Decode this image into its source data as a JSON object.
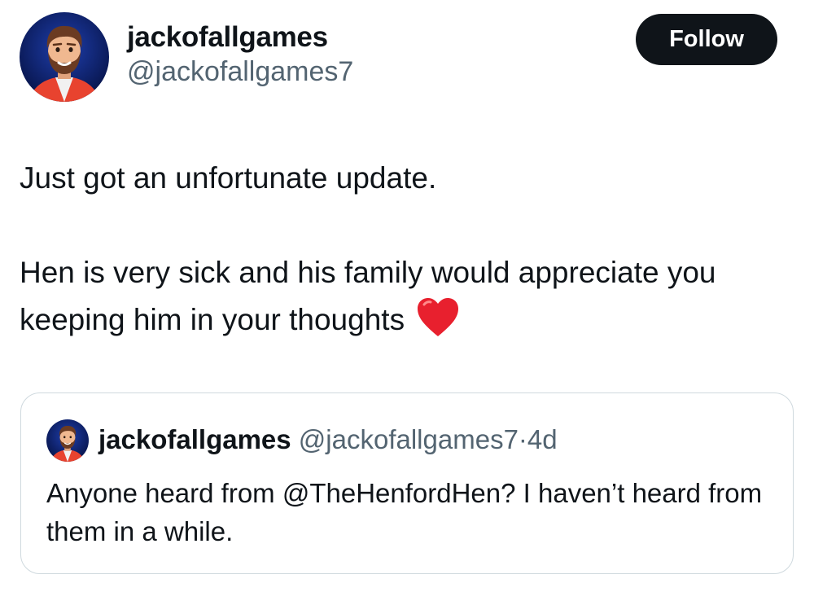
{
  "post": {
    "author": {
      "display_name": "jackofallgames",
      "handle": "@jackofallgames7",
      "avatar_icon": "cartoon-bearded-man-avatar"
    },
    "follow_label": "Follow",
    "text_line_1": "Just got an unfortunate update.",
    "text_line_2": "Hen is very sick and his family would appreciate you keeping him in your thoughts",
    "emoji": "red-heart"
  },
  "quoted_post": {
    "author": {
      "display_name": "jackofallgames",
      "handle": "@jackofallgames7",
      "separator": "·",
      "time": "4d",
      "avatar_icon": "cartoon-bearded-man-avatar"
    },
    "text": "Anyone heard from @TheHenfordHen? I haven’t heard from them in a while."
  },
  "colors": {
    "text_primary": "#0f1419",
    "text_secondary": "#536471",
    "follow_button_bg": "#0f1419",
    "quote_border": "#cfd9de",
    "heart": "#e8202e"
  }
}
